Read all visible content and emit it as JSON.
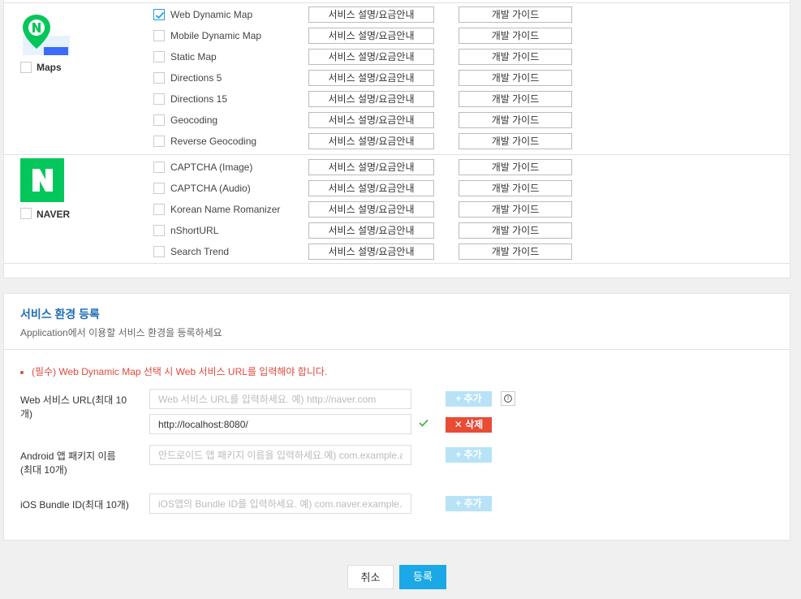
{
  "api_groups": [
    {
      "label": "Maps",
      "icon": "naver-maps-logo-icon",
      "apis": [
        {
          "name": "Web Dynamic Map",
          "checked": true
        },
        {
          "name": "Mobile Dynamic Map",
          "checked": false
        },
        {
          "name": "Static Map",
          "checked": false
        },
        {
          "name": "Directions 5",
          "checked": false
        },
        {
          "name": "Directions 15",
          "checked": false
        },
        {
          "name": "Geocoding",
          "checked": false
        },
        {
          "name": "Reverse Geocoding",
          "checked": false
        }
      ]
    },
    {
      "label": "NAVER",
      "icon": "naver-logo-icon",
      "apis": [
        {
          "name": "CAPTCHA (Image)",
          "checked": false
        },
        {
          "name": "CAPTCHA (Audio)",
          "checked": false
        },
        {
          "name": "Korean Name Romanizer",
          "checked": false
        },
        {
          "name": "nShortURL",
          "checked": false
        },
        {
          "name": "Search Trend",
          "checked": false
        }
      ]
    }
  ],
  "api_buttons": {
    "service_label": "서비스 설명/요금안내",
    "guide_label": "개발 가이드"
  },
  "env": {
    "title": "서비스 환경 등록",
    "subtitle": "Application에서 이용할 서비스 환경을 등록하세요",
    "notice": "(필수) Web Dynamic Map 선택 시 Web 서비스 URL를 입력해야 합니다.",
    "web": {
      "label_line1": "Web 서비스 URL(최대 10",
      "label_line2": "개)",
      "placeholder": "Web 서비스 URL를 입력하세요. 예) http://naver.com",
      "registered_value": "http://localhost:8080/"
    },
    "android": {
      "label_line1": "Android 앱 패키지 이름",
      "label_line2": "(최대 10개)",
      "placeholder": "안드로이드 앱 패키지 이름을 입력하세요.예) com.example.app"
    },
    "ios": {
      "label": "iOS Bundle ID(최대 10개)",
      "placeholder": "iOS앱의 Bundle ID를 입력하세요. 예) com.naver.example.app"
    },
    "add_label": "+ 추가",
    "delete_label": "✕ 삭제"
  },
  "footer": {
    "cancel": "취소",
    "submit": "등록"
  },
  "colors": {
    "accent": "#1aa9e6",
    "naver_green": "#03c75a",
    "danger": "#e94b35",
    "notice": "#e2483d"
  }
}
